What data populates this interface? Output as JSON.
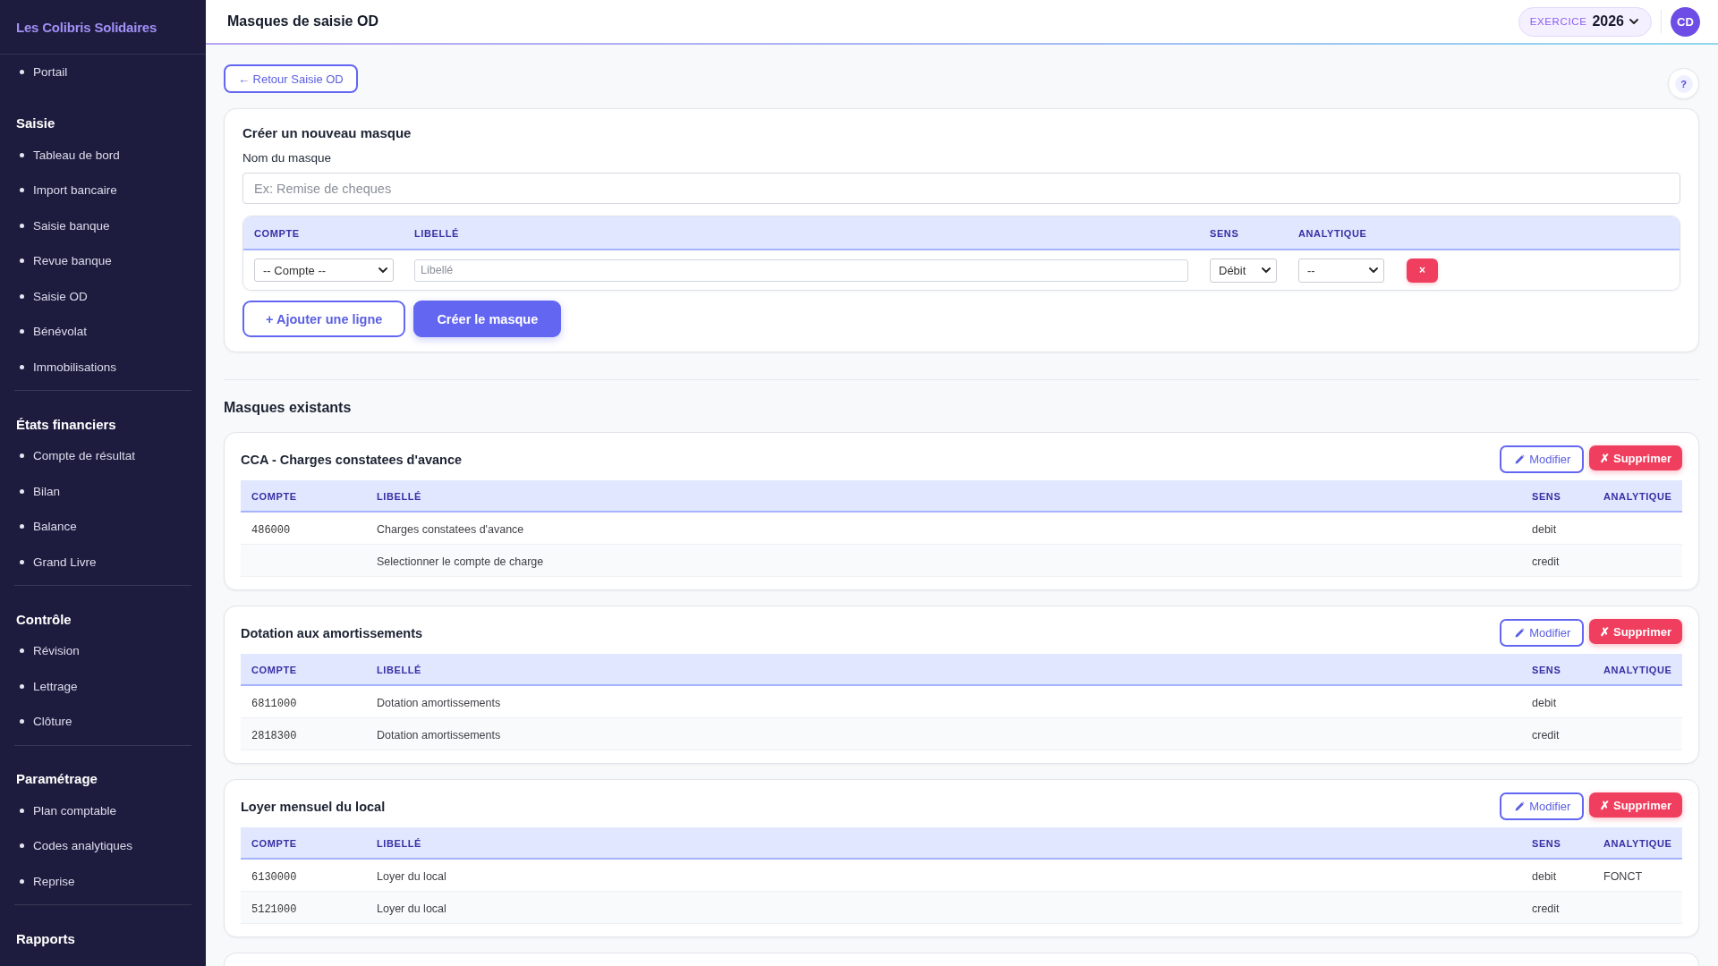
{
  "sidebar": {
    "brand": "Les Colibris Solidaires",
    "sections": [
      {
        "items": [
          "Portail"
        ]
      },
      {
        "title": "Saisie",
        "items": [
          "Tableau de bord",
          "Import bancaire",
          "Saisie banque",
          "Revue banque",
          "Saisie OD",
          "Bénévolat",
          "Immobilisations"
        ]
      },
      {
        "title": "États financiers",
        "items": [
          "Compte de résultat",
          "Bilan",
          "Balance",
          "Grand Livre"
        ]
      },
      {
        "title": "Contrôle",
        "items": [
          "Révision",
          "Lettrage",
          "Clôture"
        ]
      },
      {
        "title": "Paramétrage",
        "items": [
          "Plan comptable",
          "Codes analytiques",
          "Reprise"
        ]
      },
      {
        "title": "Rapports"
      }
    ]
  },
  "header": {
    "title": "Masques de saisie OD",
    "exercise": {
      "label": "EXERCICE",
      "value": "2026"
    },
    "avatar": "CD"
  },
  "toolbar": {
    "back_button": "← Retour Saisie OD",
    "help_button": "?"
  },
  "create_form": {
    "title": "Créer un nouveau masque",
    "name_field": {
      "label": "Nom du masque",
      "placeholder": "Ex: Remise de cheques"
    },
    "columns": [
      "COMPTE",
      "LIBELLÉ",
      "SENS",
      "ANALYTIQUE"
    ],
    "lines": [
      {
        "account": {
          "value": "-- Compte --"
        },
        "label": {
          "placeholder": "Libellé"
        },
        "direction": {
          "value": "Débit"
        },
        "analytic": {
          "value": "--"
        },
        "remove": "×"
      }
    ],
    "buttons": [
      {
        "kind": "outline",
        "label": "+ Ajouter une ligne"
      },
      {
        "kind": "primary",
        "label": "Créer le masque"
      }
    ]
  },
  "existing": {
    "title": "Masques existants",
    "more_below": true,
    "masks": [
      {
        "title": "CCA - Charges constatees d'avance",
        "actions": [
          {
            "kind": "edit",
            "label": "Modifier"
          },
          {
            "kind": "delete",
            "label": "✗ Supprimer"
          }
        ],
        "columns": [
          "COMPTE",
          "LIBELLÉ",
          "SENS",
          "ANALYTIQUE"
        ],
        "rows": [
          {
            "account": "486000",
            "label": "Charges constatees d'avance",
            "direction": "debit"
          },
          {
            "label": "Selectionner le compte de charge",
            "direction": "credit"
          }
        ]
      },
      {
        "title": "Dotation aux amortissements",
        "actions": [
          {
            "kind": "edit",
            "label": "Modifier"
          },
          {
            "kind": "delete",
            "label": "✗ Supprimer"
          }
        ],
        "columns": [
          "COMPTE",
          "LIBELLÉ",
          "SENS",
          "ANALYTIQUE"
        ],
        "rows": [
          {
            "account": "6811000",
            "label": "Dotation amortissements",
            "direction": "debit"
          },
          {
            "account": "2818300",
            "label": "Dotation amortissements",
            "direction": "credit"
          }
        ]
      },
      {
        "title": "Loyer mensuel du local",
        "actions": [
          {
            "kind": "edit",
            "label": "Modifier"
          },
          {
            "kind": "delete",
            "label": "✗ Supprimer"
          }
        ],
        "columns": [
          "COMPTE",
          "LIBELLÉ",
          "SENS",
          "ANALYTIQUE"
        ],
        "rows": [
          {
            "account": "6130000",
            "label": "Loyer du local",
            "direction": "debit",
            "analytic": "FONCT"
          },
          {
            "account": "5121000",
            "label": "Loyer du local",
            "direction": "credit"
          }
        ]
      }
    ]
  }
}
